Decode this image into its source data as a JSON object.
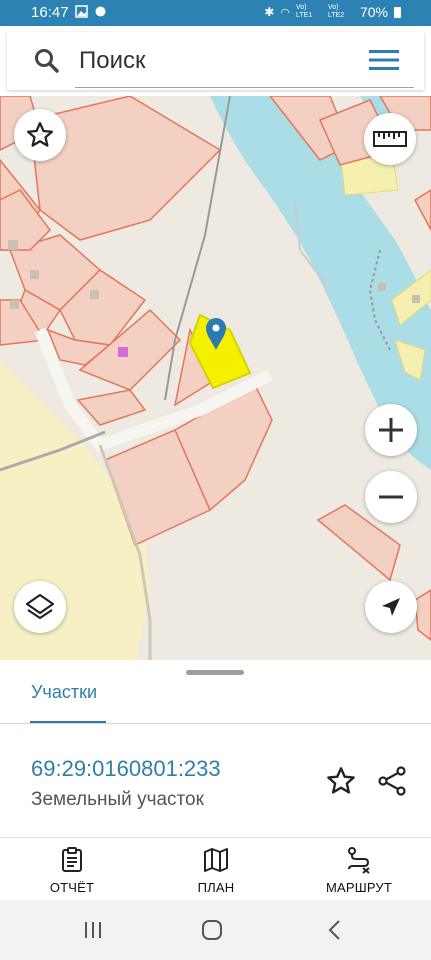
{
  "status": {
    "time": "16:47",
    "battery": "70%",
    "sim1": "Vo) LTE1",
    "sim2": "Vo) LTE2"
  },
  "search": {
    "placeholder": "Поиск"
  },
  "sheet": {
    "tab": "Участки",
    "parcel_id": "69:29:0160801:233",
    "parcel_type": "Земельный участок"
  },
  "bottom_nav": {
    "report": "ОТЧЁТ",
    "plan": "ПЛАН",
    "route": "МАРШРУТ"
  },
  "colors": {
    "accent": "#2e7fa8",
    "water": "#aadde5",
    "parcel_fill": "#f3d0c2",
    "parcel_stroke": "#e2775c",
    "selected": "#f5f000"
  }
}
